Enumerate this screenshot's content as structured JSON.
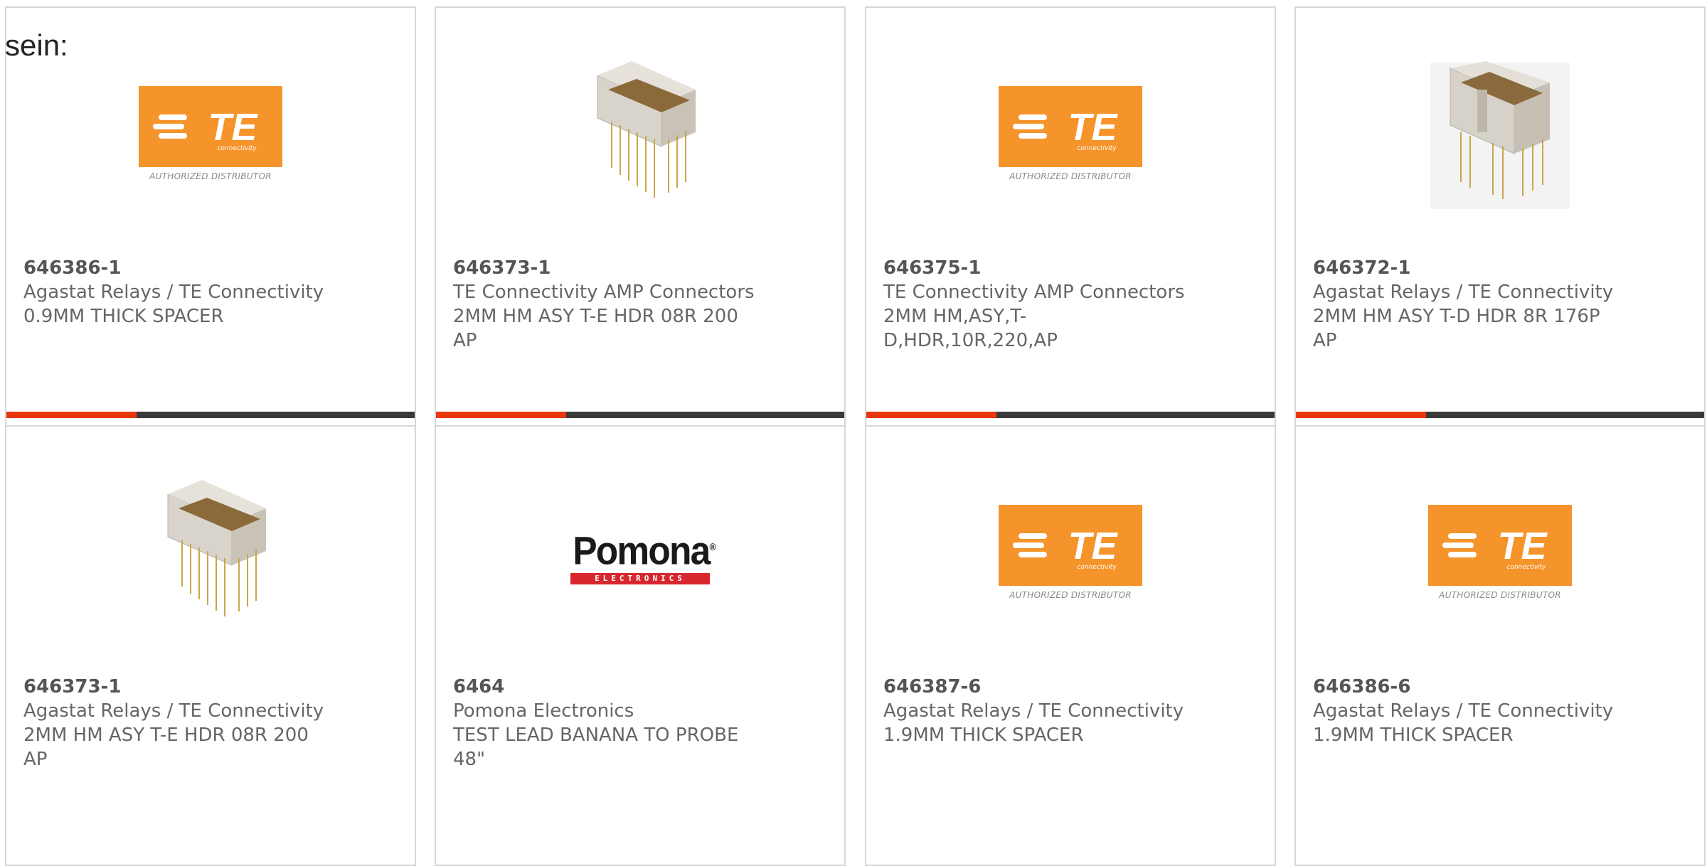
{
  "intro_text": "sein:",
  "colors": {
    "accent": "#e8380d",
    "bar_dark": "#3a3a3a",
    "te_orange": "#f5942b",
    "pomona_red": "#d8262f"
  },
  "te_logo": {
    "word": "TE",
    "sub": "connectivity",
    "badge": "AUTHORIZED DISTRIBUTOR"
  },
  "pomona_logo": {
    "word": "Pomona",
    "sub": "ELECTRONICS"
  },
  "products": [
    {
      "image": "te-logo",
      "part": "646386-1",
      "manufacturer": "Agastat Relays / TE Connectivity",
      "description": "0.9MM THICK SPACER"
    },
    {
      "image": "connector-photo",
      "part": "646373-1",
      "manufacturer": "TE Connectivity AMP Connectors",
      "description": "2MM HM ASY T-E HDR 08R 200 AP"
    },
    {
      "image": "te-logo",
      "part": "646375-1",
      "manufacturer": "TE Connectivity AMP Connectors",
      "description": "2MM HM,ASY,T-D,HDR,10R,220,AP"
    },
    {
      "image": "connector-photo-split",
      "part": "646372-1",
      "manufacturer": "Agastat Relays / TE Connectivity",
      "description": "2MM HM ASY T-D HDR 8R 176P AP"
    },
    {
      "image": "connector-photo",
      "part": "646373-1",
      "manufacturer": "Agastat Relays / TE Connectivity",
      "description": "2MM HM ASY T-E HDR 08R 200 AP"
    },
    {
      "image": "pomona-logo",
      "part": "6464",
      "manufacturer": "Pomona Electronics",
      "description": "TEST LEAD BANANA TO PROBE 48\""
    },
    {
      "image": "te-logo",
      "part": "646387-6",
      "manufacturer": "Agastat Relays / TE Connectivity",
      "description": "1.9MM THICK SPACER"
    },
    {
      "image": "te-logo",
      "part": "646386-6",
      "manufacturer": "Agastat Relays / TE Connectivity",
      "description": "1.9MM THICK SPACER"
    }
  ]
}
